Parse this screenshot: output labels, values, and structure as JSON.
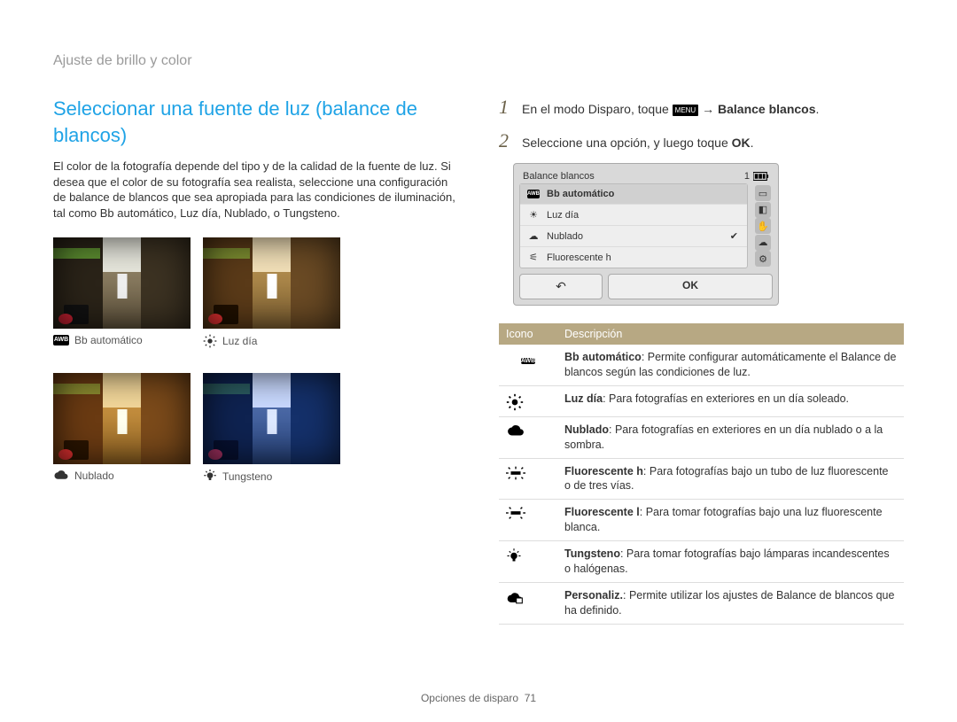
{
  "breadcrumb": "Ajuste de brillo y color",
  "title": "Seleccionar una fuente de luz (balance de blancos)",
  "intro": "El color de la fotografía depende del tipo y de la calidad de la fuente de luz. Si desea que el color de su fotografía sea realista, seleccione una configuración de balance de blancos que sea apropiada para las condiciones de iluminación, tal como Bb automático, Luz día, Nublado, o Tungsteno.",
  "samples": {
    "auto": "Bb automático",
    "day": "Luz día",
    "cloud": "Nublado",
    "tungsten": "Tungsteno",
    "awb_badge": "AWB"
  },
  "steps": {
    "s1_pre": "En el modo Disparo, toque ",
    "s1_menu": "MENU",
    "s1_arrow": " → ",
    "s1_post": "Balance blancos",
    "s1_dot": ".",
    "s2_pre": "Seleccione una opción, y luego toque ",
    "s2_ok": "OK",
    "s2_dot": "."
  },
  "lcd": {
    "title": "Balance blancos",
    "rows": [
      "Bb automático",
      "Luz día",
      "Nublado",
      "Fluorescente h"
    ],
    "back": "↶",
    "ok": "OK",
    "count": "1",
    "side": [
      "▭",
      "◧",
      "✋",
      "☁",
      "⚙"
    ]
  },
  "table": {
    "head_icon": "Icono",
    "head_desc": "Descripción",
    "rows": [
      {
        "icon": "awb",
        "b": "Bb automático",
        "t": ": Permite configurar automáticamente el Balance de blancos según las condiciones de luz."
      },
      {
        "icon": "sun",
        "b": "Luz día",
        "t": ": Para fotografías en exteriores en un día soleado."
      },
      {
        "icon": "cloud",
        "b": "Nublado",
        "t": ": Para fotografías en exteriores en un día nublado o a la sombra."
      },
      {
        "icon": "fluoh",
        "b": "Fluorescente h",
        "t": ": Para fotografías bajo un tubo de luz fluorescente o de tres vías."
      },
      {
        "icon": "fluol",
        "b": "Fluorescente l",
        "t": ": Para tomar fotografías bajo una luz fluorescente blanca."
      },
      {
        "icon": "tung",
        "b": "Tungsteno",
        "t": ": Para tomar fotografías bajo lámparas incandescentes o halógenas."
      },
      {
        "icon": "custom",
        "b": "Personaliz.",
        "t": ": Permite utilizar los ajustes de Balance de blancos que ha definido."
      }
    ]
  },
  "footer_section": "Opciones de disparo",
  "footer_page": "71"
}
